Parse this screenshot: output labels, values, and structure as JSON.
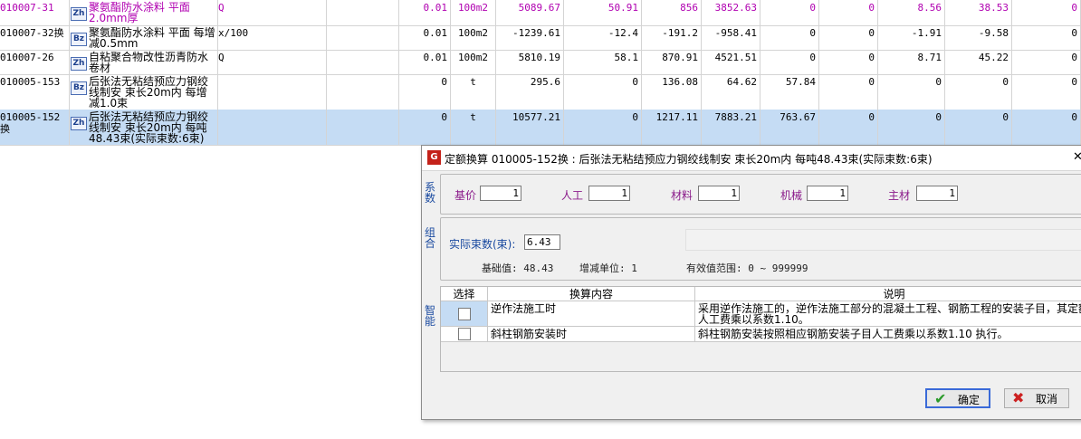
{
  "grid": {
    "rows": [
      {
        "code": "010007-31",
        "badge": "Zh",
        "name": "聚氨酯防水涂料 平面 2.0mm厚",
        "formula": "Q",
        "qty": "0.01",
        "unit": "100m2",
        "c1": "5089.67",
        "c2": "50.91",
        "c3": "856",
        "c4": "3852.63",
        "c5": "0",
        "c6": "0",
        "c7": "8.56",
        "c8": "38.53",
        "c9": "0",
        "pink": true,
        "selected": false
      },
      {
        "code": "010007-32换",
        "badge": "Bz",
        "name": "聚氨酯防水涂料 平面 每增减0.5mm",
        "formula": "x/100",
        "qty": "0.01",
        "unit": "100m2",
        "c1": "-1239.61",
        "c2": "-12.4",
        "c3": "-191.2",
        "c4": "-958.41",
        "c5": "0",
        "c6": "0",
        "c7": "-1.91",
        "c8": "-9.58",
        "c9": "0",
        "pink": false,
        "selected": false
      },
      {
        "code": "010007-26",
        "badge": "Zh",
        "name": "自粘聚合物改性沥青防水卷材",
        "formula": "Q",
        "qty": "0.01",
        "unit": "100m2",
        "c1": "5810.19",
        "c2": "58.1",
        "c3": "870.91",
        "c4": "4521.51",
        "c5": "0",
        "c6": "0",
        "c7": "8.71",
        "c8": "45.22",
        "c9": "0",
        "pink": false,
        "selected": false
      },
      {
        "code": "010005-153",
        "badge": "Bz",
        "name": "后张法无粘结预应力钢绞线制安 束长20m内 每增减1.0束",
        "formula": "",
        "qty": "0",
        "unit": "t",
        "c1": "295.6",
        "c2": "0",
        "c3": "136.08",
        "c4": "64.62",
        "c5": "57.84",
        "c6": "0",
        "c7": "0",
        "c8": "0",
        "c9": "0",
        "pink": false,
        "selected": false
      },
      {
        "code": "010005-152换",
        "badge": "Zh",
        "name": "后张法无粘结预应力钢绞线制安 束长20m内 每吨48.43束(实际束数:6束)",
        "formula": "",
        "qty": "0",
        "unit": "t",
        "c1": "10577.21",
        "c2": "0",
        "c3": "1217.11",
        "c4": "7883.21",
        "c5": "763.67",
        "c6": "0",
        "c7": "0",
        "c8": "0",
        "c9": "0",
        "pink": false,
        "selected": true
      }
    ]
  },
  "dialog": {
    "title": "定额换算   010005-152换 : 后张法无粘结预应力钢绞线制安 束长20m内 每吨48.43束(实际束数:6束)",
    "close_glyph": "✕",
    "logo_glyph": "G",
    "coef_section_label": "系数",
    "coef": {
      "base_label": "基价",
      "base_value": "1",
      "labor_label": "人工",
      "labor_value": "1",
      "material_label": "材料",
      "material_value": "1",
      "machine_label": "机械",
      "machine_value": "1",
      "main_label": "主材",
      "main_value": "1"
    },
    "combo_section_label": "组合",
    "combo": {
      "actual_label": "实际束数(束):",
      "actual_value": "6.43",
      "base_value_text": "基础值: 48.43",
      "step_text": "增减单位: 1",
      "range_text": "有效值范围: 0 ~ 999999"
    },
    "smart_section_label": "智能",
    "smart_table": {
      "headers": [
        "选择",
        "换算内容",
        "说明"
      ],
      "rows": [
        {
          "content": "逆作法施工时",
          "desc": "采用逆作法施工的，逆作法施工部分的混凝土工程、钢筋工程的安装子目，其定额人工费乘以系数1.10。"
        },
        {
          "content": "斜柱钢筋安装时",
          "desc": "斜柱钢筋安装按照相应钢筋安装子目人工费乘以系数1.10 执行。"
        }
      ]
    },
    "ok_label": "确定",
    "cancel_label": "取消"
  }
}
